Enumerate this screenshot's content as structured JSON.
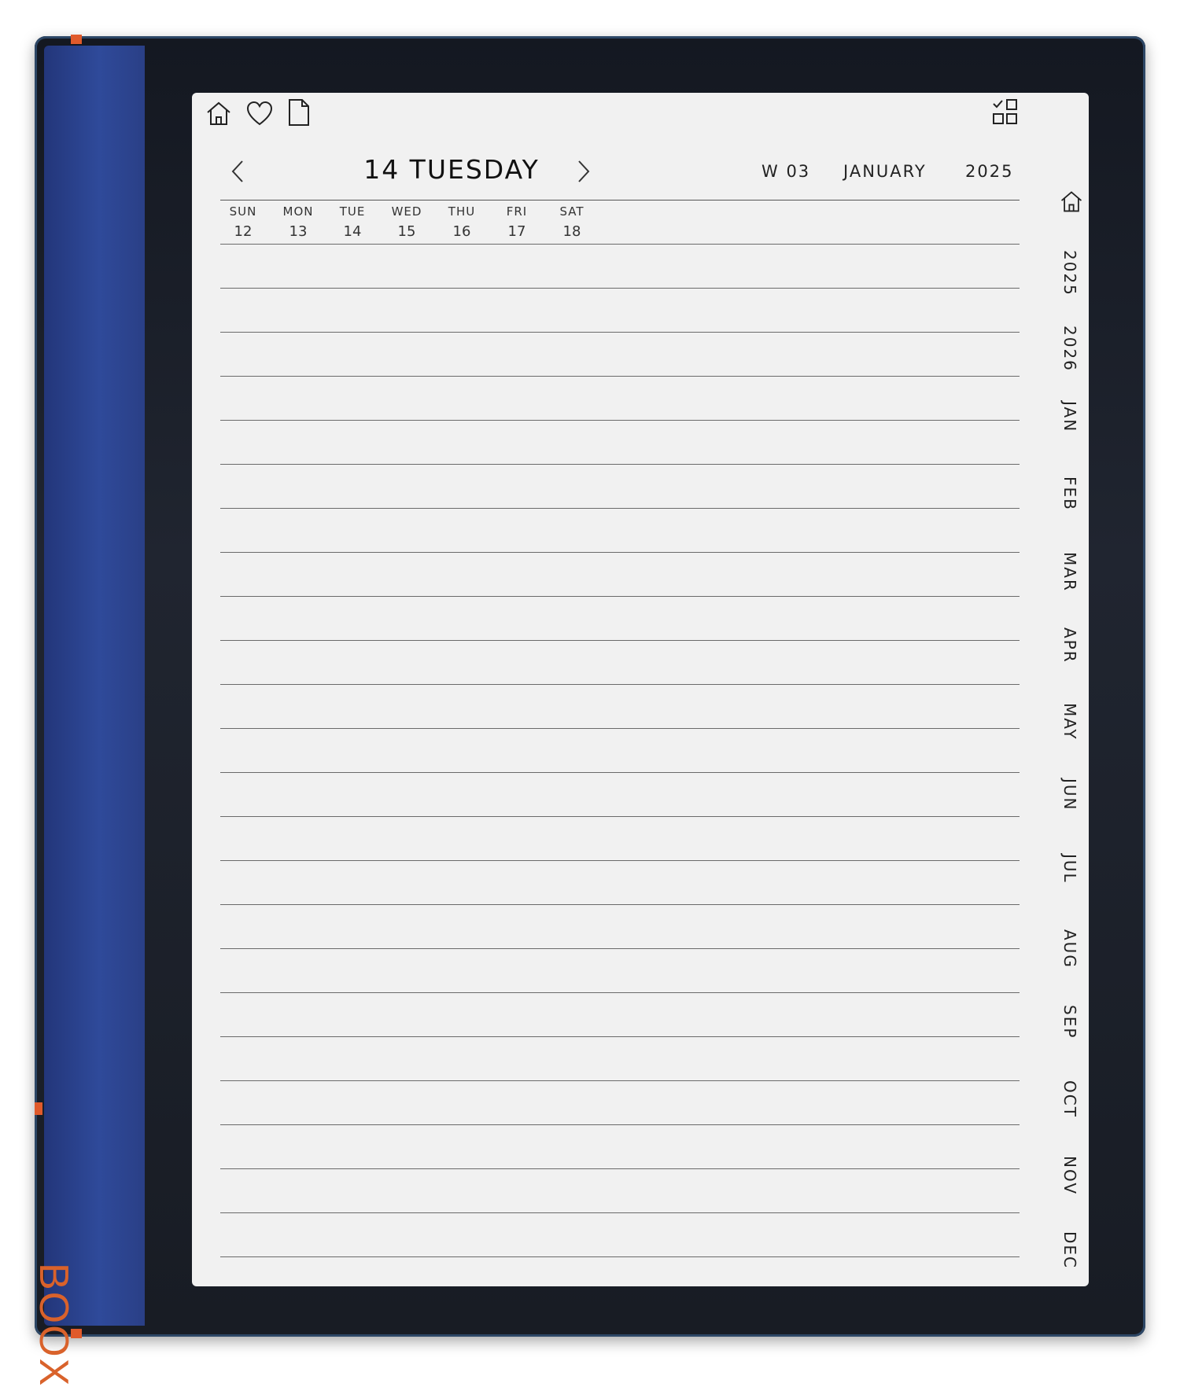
{
  "device": {
    "brand_logo": "BOOX",
    "accent_color": "#e05a2b",
    "spine_color": "#2f4a9a"
  },
  "toolbar": {
    "icons": [
      "home-icon",
      "heart-icon",
      "document-icon",
      "layout-grid-icon"
    ]
  },
  "header": {
    "title": "14 TUESDAY",
    "prev_icon": "chevron-left-icon",
    "next_icon": "chevron-right-icon",
    "week": "W 03",
    "month": "JANUARY",
    "year": "2025"
  },
  "week_strip": [
    {
      "name": "SUN",
      "date": "12"
    },
    {
      "name": "MON",
      "date": "13"
    },
    {
      "name": "TUE",
      "date": "14"
    },
    {
      "name": "WED",
      "date": "15"
    },
    {
      "name": "THU",
      "date": "16"
    },
    {
      "name": "FRI",
      "date": "17"
    },
    {
      "name": "SAT",
      "date": "18"
    }
  ],
  "side_nav": {
    "home_icon": "home-icon",
    "tabs": [
      "2025",
      "2026",
      "JAN",
      "FEB",
      "MAR",
      "APR",
      "MAY",
      "JUN",
      "JUL",
      "AUG",
      "SEP",
      "OCT",
      "NOV",
      "DEC"
    ]
  },
  "notes": {
    "line_count": 24
  }
}
